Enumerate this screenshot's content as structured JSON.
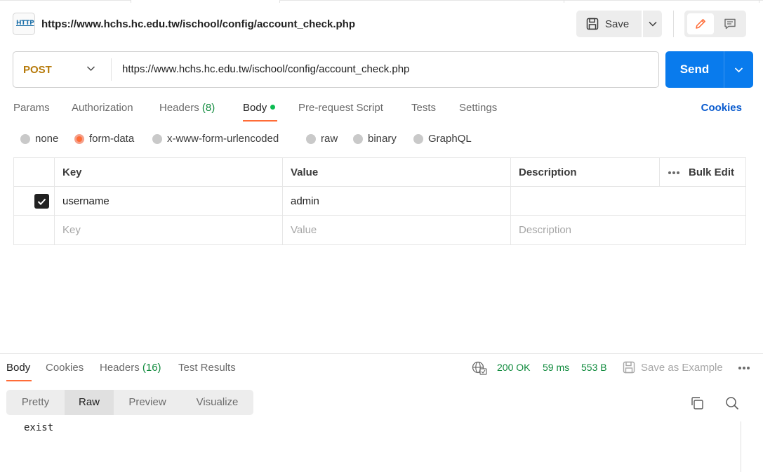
{
  "request": {
    "icon_label": "HTTP",
    "title": "https://www.hchs.hc.edu.tw/ischool/config/account_check.php",
    "save_label": "Save",
    "method": "POST",
    "url": "https://www.hchs.hc.edu.tw/ischool/config/account_check.php",
    "send_label": "Send"
  },
  "request_tabs": {
    "params": "Params",
    "authorization": "Authorization",
    "headers": "Headers",
    "headers_count": "(8)",
    "body": "Body",
    "prerequest": "Pre-request Script",
    "tests": "Tests",
    "settings": "Settings",
    "cookies": "Cookies",
    "active": "Body"
  },
  "body_types": {
    "none": "none",
    "form_data": "form-data",
    "urlencoded": "x-www-form-urlencoded",
    "raw": "raw",
    "binary": "binary",
    "graphql": "GraphQL",
    "selected": "form-data"
  },
  "form_table": {
    "headers": {
      "key": "Key",
      "value": "Value",
      "description": "Description",
      "bulk_edit": "Bulk Edit"
    },
    "rows": [
      {
        "checked": true,
        "key": "username",
        "value": "admin",
        "description": ""
      }
    ],
    "placeholder": {
      "key": "Key",
      "value": "Value",
      "description": "Description"
    }
  },
  "response": {
    "tabs": {
      "body": "Body",
      "cookies": "Cookies",
      "headers": "Headers",
      "headers_count": "(16)",
      "test_results": "Test Results"
    },
    "status": "200 OK",
    "time": "59 ms",
    "size": "553 B",
    "save_example": "Save as Example",
    "views": {
      "pretty": "Pretty",
      "raw": "Raw",
      "preview": "Preview",
      "visualize": "Visualize",
      "active": "Raw"
    },
    "body_text": "exist"
  },
  "colors": {
    "accent_orange": "#ff6c37",
    "send_blue": "#097bed",
    "method_post": "#b67a0a",
    "status_green": "#0f8a3c",
    "link_blue": "#0b5ccf"
  }
}
